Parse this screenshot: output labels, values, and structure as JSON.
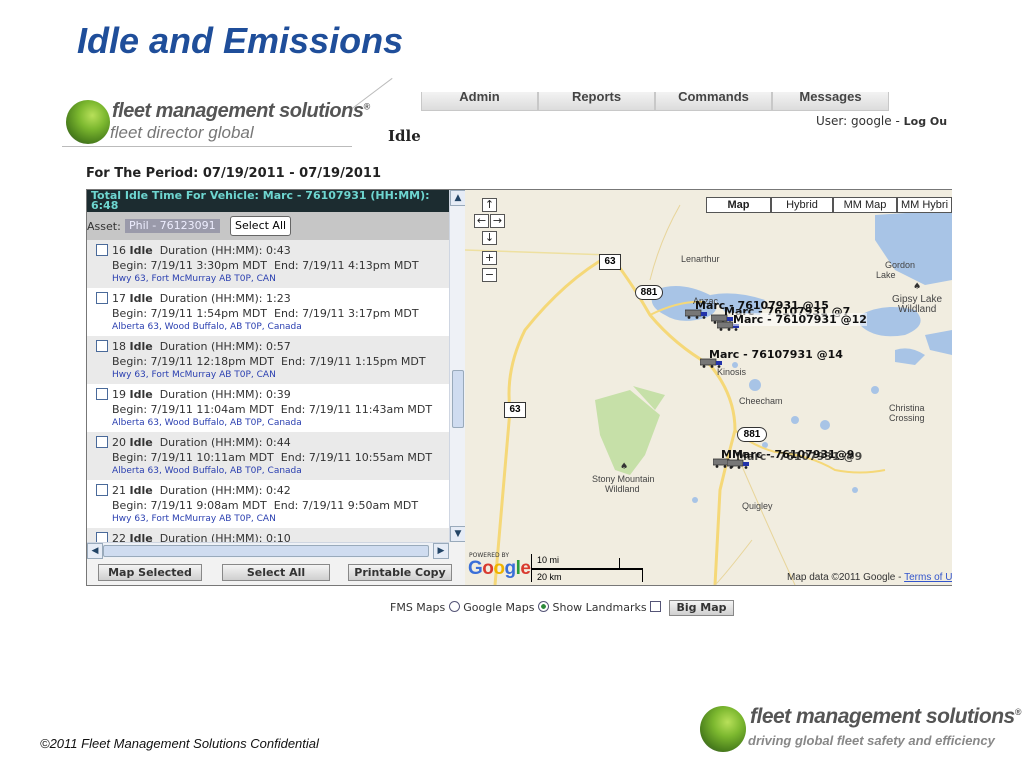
{
  "slide": {
    "title": "Idle and Emissions",
    "footer": "©2011 Fleet Management Solutions Confidential"
  },
  "brand": {
    "name": "fleet management solutions",
    "registered": "®",
    "product": "fleet director global",
    "tagline": "driving global fleet safety and efficiency"
  },
  "nav": {
    "tabs": [
      "Admin",
      "Reports",
      "Commands",
      "Messages"
    ],
    "page_title": "Idle",
    "user_label": "User:",
    "user_name": "google",
    "logout": "Log Ou"
  },
  "period": "For The Period: 07/19/2011 - 07/19/2011",
  "idle_panel": {
    "total_text": "Total Idle Time For Vehicle: Marc - 76107931 (HH:MM): 6:48",
    "asset_label": "Asset:",
    "asset_value": "Phil - 76123091",
    "select_all_label": "Select All",
    "events": [
      {
        "num": "16",
        "type": "Idle",
        "duration_label": "Duration (HH:MM):",
        "duration": "0:43",
        "begin": "Begin: 7/19/11 3:30pm MDT",
        "end": "End: 7/19/11 4:13pm MDT",
        "location": "Hwy 63, Fort McMurray AB T0P, CAN"
      },
      {
        "num": "17",
        "type": "Idle",
        "duration_label": "Duration (HH:MM):",
        "duration": "1:23",
        "begin": "Begin: 7/19/11 1:54pm MDT",
        "end": "End: 7/19/11 3:17pm MDT",
        "location": "Alberta 63, Wood Buffalo, AB T0P, Canada"
      },
      {
        "num": "18",
        "type": "Idle",
        "duration_label": "Duration (HH:MM):",
        "duration": "0:57",
        "begin": "Begin: 7/19/11 12:18pm MDT",
        "end": "End: 7/19/11 1:15pm MDT",
        "location": "Hwy 63, Fort McMurray AB T0P, CAN"
      },
      {
        "num": "19",
        "type": "Idle",
        "duration_label": "Duration (HH:MM):",
        "duration": "0:39",
        "begin": "Begin: 7/19/11 11:04am MDT",
        "end": "End: 7/19/11 11:43am MDT",
        "location": "Alberta 63, Wood Buffalo, AB T0P, Canada"
      },
      {
        "num": "20",
        "type": "Idle",
        "duration_label": "Duration (HH:MM):",
        "duration": "0:44",
        "begin": "Begin: 7/19/11 10:11am MDT",
        "end": "End: 7/19/11 10:55am MDT",
        "location": "Alberta 63, Wood Buffalo, AB T0P, Canada"
      },
      {
        "num": "21",
        "type": "Idle",
        "duration_label": "Duration (HH:MM):",
        "duration": "0:42",
        "begin": "Begin: 7/19/11 9:08am MDT",
        "end": "End: 7/19/11 9:50am MDT",
        "location": "Hwy 63, Fort McMurray AB T0P, CAN"
      },
      {
        "num": "22",
        "type": "Idle",
        "duration_label": "Duration (HH:MM):",
        "duration": "0:10",
        "begin": "",
        "end": "",
        "location": ""
      }
    ],
    "buttons": {
      "map_selected": "Map Selected",
      "select_all": "Select All",
      "printable_copy": "Printable Copy"
    }
  },
  "map": {
    "types": [
      "Map",
      "Hybrid",
      "MM Map",
      "MM Hybri"
    ],
    "zoom_in": "+",
    "zoom_out": "−",
    "places": {
      "lenarthur": "Lenarthur",
      "gordon": "Gordon",
      "lake": "Lake",
      "gipsy": "Gipsy Lake",
      "wildland": "Wildland",
      "anzac": "Anzac",
      "kinosis": "Kinosis",
      "cheecham": "Cheecham",
      "christina": "Christina",
      "crossing": "Crossing",
      "stony": "Stony Mountain",
      "stony_wild": "Wildland",
      "quigley": "Quigley"
    },
    "highways": {
      "h63a": "63",
      "h881a": "881",
      "h63b": "63",
      "h881b": "881"
    },
    "vehicles": {
      "v15": "Marc - 76107931 @15",
      "v7": "Marc - 76107931 @7",
      "v12": "Marc - 76107931 @12",
      "v14": "Marc - 76107931 @14",
      "v9a": "MMarc - 76107931@9",
      "v9b": "Marc - 76107931 @9"
    },
    "powered_by": "POWERED BY",
    "google": "Google",
    "scale_mi": "10 mi",
    "scale_km": "20 km",
    "attribution": "Map data ©2011 Google -",
    "terms": "Terms of U",
    "colors": {
      "water": "#a8c4e6",
      "park": "#c6e0a8",
      "land": "#f1ede0",
      "road": "#f5d878"
    }
  },
  "map_options": {
    "fms_maps": "FMS Maps",
    "google_maps": "Google Maps",
    "show_landmarks": "Show Landmarks",
    "big_map": "Big Map",
    "selected": "Google Maps"
  }
}
